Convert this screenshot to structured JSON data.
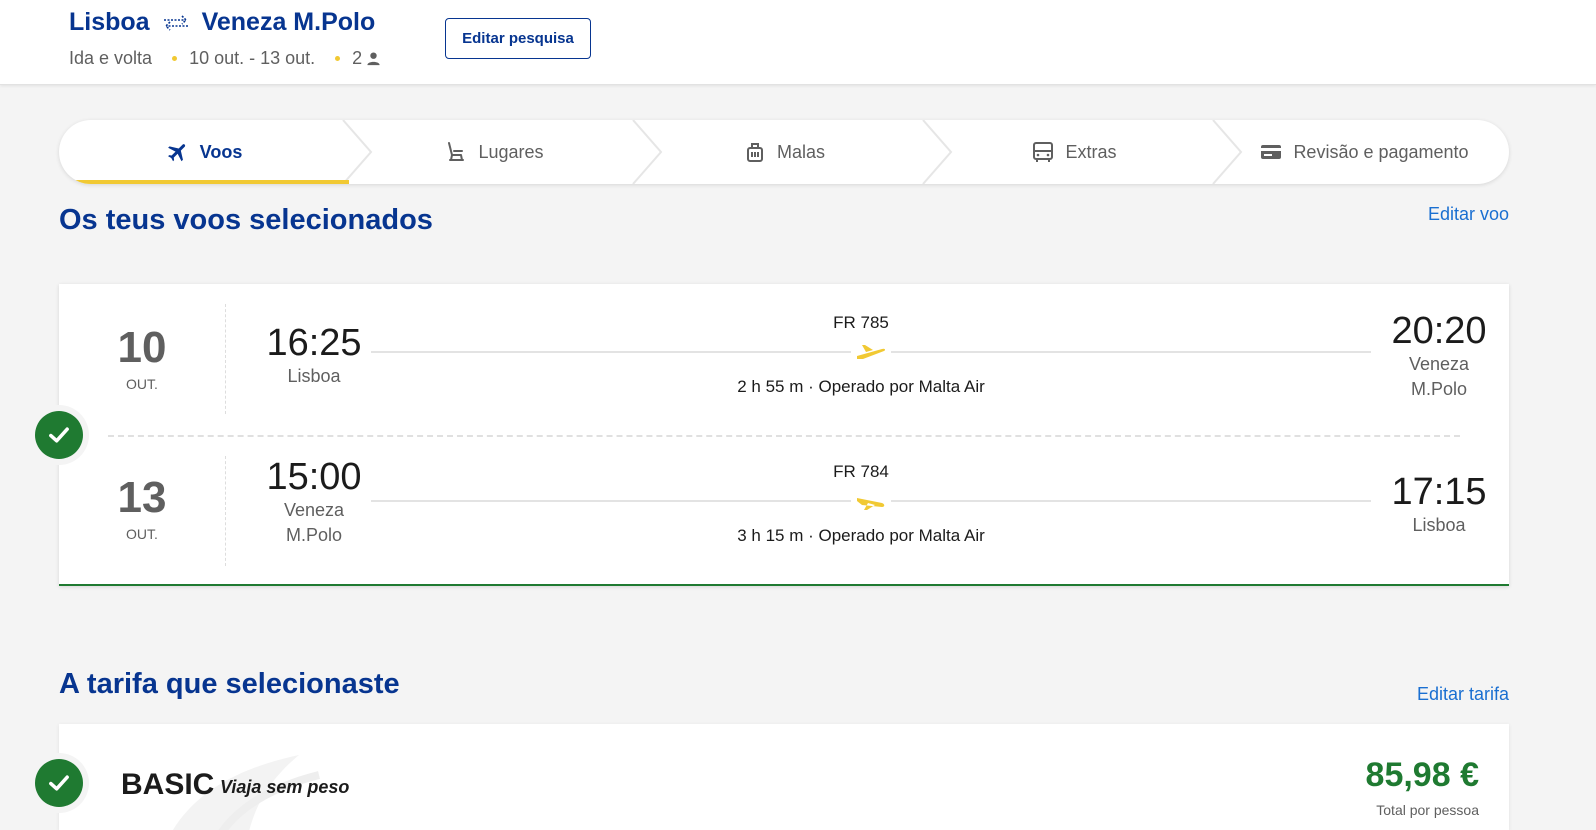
{
  "header": {
    "origin": "Lisboa",
    "destination": "Veneza M.Polo",
    "trip_type": "Ida e volta",
    "dates": "10 out. - 13 out.",
    "passengers": "2",
    "edit_search_label": "Editar pesquisa"
  },
  "stepper": {
    "steps": [
      {
        "label": "Voos",
        "icon": "plane-icon",
        "active": true
      },
      {
        "label": "Lugares",
        "icon": "seat-icon",
        "active": false
      },
      {
        "label": "Malas",
        "icon": "luggage-icon",
        "active": false
      },
      {
        "label": "Extras",
        "icon": "bus-icon",
        "active": false
      },
      {
        "label": "Revisão e pagamento",
        "icon": "credit-card-icon",
        "active": false
      }
    ]
  },
  "flights_section": {
    "title": "Os teus voos selecionados",
    "edit_label": "Editar voo",
    "legs": [
      {
        "day": "10",
        "month": "OUT.",
        "dep_time": "16:25",
        "dep_city": "Lisboa",
        "flight_number": "FR 785",
        "duration_info": "2 h 55 m · Operado por Malta Air",
        "arr_time": "20:20",
        "arr_city": "Veneza M.Polo"
      },
      {
        "day": "13",
        "month": "OUT.",
        "dep_time": "15:00",
        "dep_city": "Veneza M.Polo",
        "flight_number": "FR 784",
        "duration_info": "3 h 15 m · Operado por Malta Air",
        "arr_time": "17:15",
        "arr_city": "Lisboa"
      }
    ]
  },
  "fare_section": {
    "title": "A tarifa que selecionaste",
    "edit_label": "Editar tarifa",
    "fare_name": "BASIC",
    "fare_tagline": "Viaja sem peso",
    "price": "85,98 €",
    "price_note": "Total por pessoa"
  },
  "colors": {
    "brand_blue": "#073590",
    "accent_yellow": "#f1c933",
    "success_green": "#1f7a31",
    "link_blue": "#1a6fd1"
  }
}
